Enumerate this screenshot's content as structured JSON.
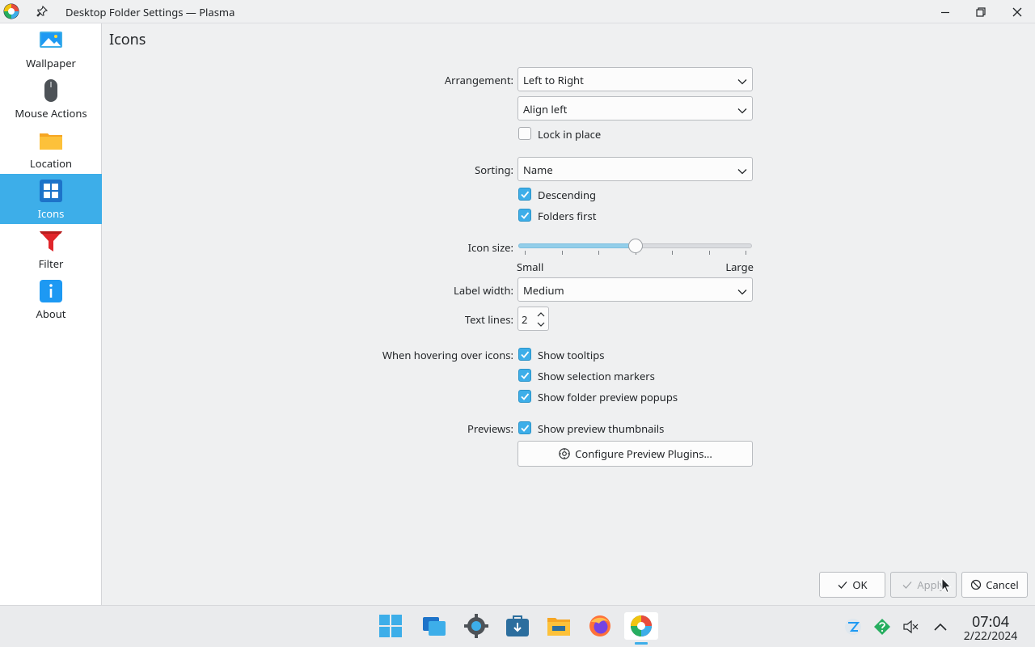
{
  "window": {
    "title": "Desktop Folder Settings — Plasma"
  },
  "sidebar": {
    "items": [
      {
        "label": "Wallpaper",
        "icon": "wallpaper-icon"
      },
      {
        "label": "Mouse Actions",
        "icon": "mouse-icon"
      },
      {
        "label": "Location",
        "icon": "folder-icon"
      },
      {
        "label": "Icons",
        "icon": "grid-icon",
        "active": true
      },
      {
        "label": "Filter",
        "icon": "funnel-icon"
      },
      {
        "label": "About",
        "icon": "info-icon"
      }
    ]
  },
  "page": {
    "title": "Icons",
    "arrangement_label": "Arrangement:",
    "arrangement_value": "Left to Right",
    "alignment_value": "Align left",
    "lock_label": "Lock in place",
    "lock_checked": false,
    "sorting_label": "Sorting:",
    "sorting_value": "Name",
    "descending_label": "Descending",
    "descending_checked": true,
    "folders_first_label": "Folders first",
    "folders_first_checked": true,
    "icon_size_label": "Icon size:",
    "icon_size_min_label": "Small",
    "icon_size_max_label": "Large",
    "icon_size_fraction": 0.5,
    "label_width_label": "Label width:",
    "label_width_value": "Medium",
    "text_lines_label": "Text lines:",
    "text_lines_value": "2",
    "hover_label": "When hovering over icons:",
    "show_tooltips_label": "Show tooltips",
    "show_selection_markers_label": "Show selection markers",
    "show_folder_preview_label": "Show folder preview popups",
    "previews_label": "Previews:",
    "show_thumbnails_label": "Show preview thumbnails",
    "configure_plugins_label": "Configure Preview Plugins..."
  },
  "buttons": {
    "ok": "OK",
    "apply": "Apply",
    "cancel": "Cancel"
  },
  "taskbar": {
    "apps": [
      "start-menu-icon",
      "overview-icon",
      "system-settings-icon",
      "discover-store-icon",
      "file-manager-icon",
      "firefox-icon",
      "plasma-settings-icon"
    ],
    "tray": [
      "network-icon",
      "help-updates-icon",
      "volume-muted-icon",
      "tray-expand-icon"
    ],
    "time": "07:04",
    "date": "2/22/2024"
  },
  "colors": {
    "accent": "#3daee9",
    "window_bg": "#eff0f1",
    "text": "#232629"
  }
}
